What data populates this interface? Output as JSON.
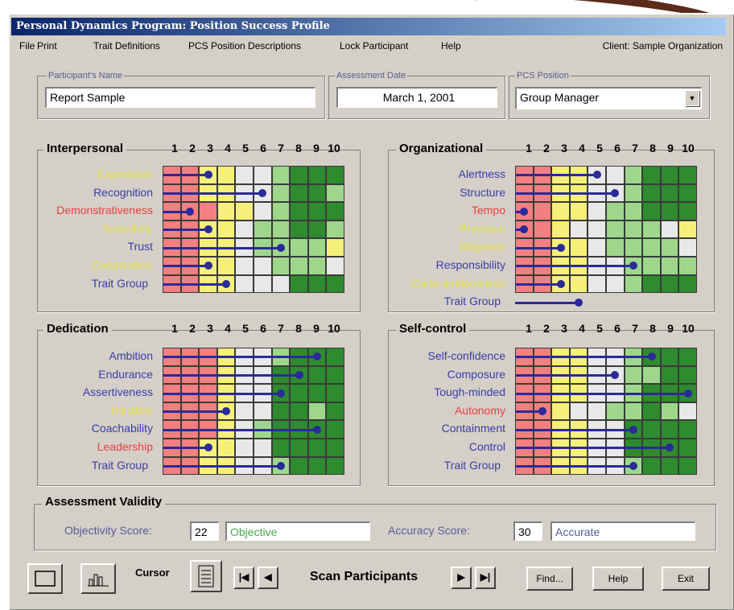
{
  "window": {
    "title": "Personal Dynamics Program: Position Success Profile"
  },
  "menu": {
    "items": [
      "File",
      "Print",
      "Trait Definitions",
      "PCS Position Descriptions",
      "Lock Participant",
      "Help"
    ],
    "client": "Client: Sample Organization"
  },
  "fields": {
    "participant_label": "Participant's Name",
    "participant_value": "Report Sample",
    "date_label": "Assessment Date",
    "date_value": "March 1, 2001",
    "position_label": "PCS Position",
    "position_value": "Group Manager"
  },
  "scale_numbers": [
    "1",
    "2",
    "3",
    "4",
    "5",
    "6",
    "7",
    "8",
    "9",
    "10"
  ],
  "colors": {
    "red": "#f28080",
    "yellow": "#f5f07a",
    "white": "#e8e8e8",
    "lightgreen": "#9ed78c",
    "green": "#2e8b2e",
    "bar": "#2a2a9a"
  },
  "sections": [
    {
      "title": "Interpersonal",
      "traits": [
        {
          "label": "Expression",
          "color": "#e8e24a",
          "score": 3
        },
        {
          "label": "Recognition",
          "color": "#3a3aa8",
          "score": 6
        },
        {
          "label": "Demonstrativeness",
          "color": "#e84040",
          "score": 2
        },
        {
          "label": "Sensitivity",
          "color": "#e8e24a",
          "score": 3
        },
        {
          "label": "Trust",
          "color": "#3a3aa8",
          "score": 7
        },
        {
          "label": "Cooperation",
          "color": "#e8e24a",
          "score": 3
        }
      ],
      "group_label": "Trait Group",
      "group_score": 4,
      "rows": [
        [
          "r",
          "r",
          "y",
          "y",
          "w",
          "w",
          "lg",
          "g",
          "g",
          "g"
        ],
        [
          "r",
          "r",
          "y",
          "y",
          "w",
          "w",
          "lg",
          "g",
          "g",
          "lg"
        ],
        [
          "r",
          "r",
          "r",
          "y",
          "y",
          "w",
          "lg",
          "g",
          "g",
          "g"
        ],
        [
          "r",
          "r",
          "y",
          "y",
          "w",
          "lg",
          "lg",
          "g",
          "g",
          "lg"
        ],
        [
          "r",
          "r",
          "y",
          "y",
          "w",
          "lg",
          "lg",
          "lg",
          "lg",
          "y"
        ],
        [
          "r",
          "r",
          "y",
          "y",
          "w",
          "w",
          "lg",
          "lg",
          "lg",
          "w"
        ],
        [
          "r",
          "r",
          "y",
          "y",
          "w",
          "w",
          "w",
          "g",
          "g",
          "g"
        ]
      ]
    },
    {
      "title": "Organizational",
      "traits": [
        {
          "label": "Alertness",
          "color": "#3a3aa8",
          "score": 5
        },
        {
          "label": "Structure",
          "color": "#3a3aa8",
          "score": 6
        },
        {
          "label": "Tempo",
          "color": "#e84040",
          "score": 1
        },
        {
          "label": "Precision",
          "color": "#e8e24a",
          "score": 1
        },
        {
          "label": "Diligence",
          "color": "#e8e24a",
          "score": 3
        },
        {
          "label": "Responsibility",
          "color": "#3a3aa8",
          "score": 7
        },
        {
          "label": "Conscientiousness",
          "color": "#e8e24a",
          "score": 3
        }
      ],
      "group_label": "Trait Group",
      "group_score": 4,
      "rows": [
        [
          "r",
          "r",
          "y",
          "y",
          "w",
          "w",
          "lg",
          "g",
          "g",
          "g"
        ],
        [
          "r",
          "r",
          "y",
          "y",
          "w",
          "w",
          "lg",
          "g",
          "g",
          "g"
        ],
        [
          "r",
          "r",
          "y",
          "y",
          "w",
          "lg",
          "lg",
          "g",
          "g",
          "g"
        ],
        [
          "r",
          "r",
          "y",
          "w",
          "w",
          "lg",
          "lg",
          "lg",
          "w",
          "y"
        ],
        [
          "r",
          "r",
          "y",
          "y",
          "w",
          "lg",
          "lg",
          "lg",
          "lg",
          "w"
        ],
        [
          "r",
          "r",
          "y",
          "y",
          "w",
          "w",
          "lg",
          "lg",
          "lg",
          "lg"
        ],
        [
          "r",
          "r",
          "y",
          "y",
          "w",
          "w",
          "lg",
          "g",
          "g",
          "g"
        ]
      ]
    },
    {
      "title": "Dedication",
      "traits": [
        {
          "label": "Ambition",
          "color": "#3a3aa8",
          "score": 9
        },
        {
          "label": "Endurance",
          "color": "#3a3aa8",
          "score": 8
        },
        {
          "label": "Assertiveness",
          "color": "#3a3aa8",
          "score": 7
        },
        {
          "label": "Initiative",
          "color": "#e8e24a",
          "score": 4
        },
        {
          "label": "Coachability",
          "color": "#3a3aa8",
          "score": 9
        },
        {
          "label": "Leadership",
          "color": "#e84040",
          "score": 3
        },
        {
          "label": "Trait Group",
          "color": "#3a3aa8",
          "score": 7
        }
      ],
      "group_label": "",
      "group_score": 0,
      "rows": [
        [
          "r",
          "r",
          "r",
          "y",
          "w",
          "w",
          "lg",
          "g",
          "g",
          "g"
        ],
        [
          "r",
          "r",
          "r",
          "y",
          "w",
          "w",
          "g",
          "g",
          "g",
          "g"
        ],
        [
          "r",
          "r",
          "r",
          "y",
          "w",
          "w",
          "g",
          "g",
          "g",
          "g"
        ],
        [
          "r",
          "r",
          "r",
          "y",
          "w",
          "w",
          "g",
          "g",
          "lg",
          "g"
        ],
        [
          "r",
          "r",
          "r",
          "y",
          "w",
          "lg",
          "g",
          "g",
          "g",
          "g"
        ],
        [
          "r",
          "r",
          "y",
          "y",
          "w",
          "w",
          "g",
          "g",
          "g",
          "g"
        ],
        [
          "r",
          "r",
          "y",
          "y",
          "w",
          "w",
          "lg",
          "g",
          "g",
          "g"
        ]
      ]
    },
    {
      "title": "Self-control",
      "traits": [
        {
          "label": "Self-confidence",
          "color": "#3a3aa8",
          "score": 8
        },
        {
          "label": "Composure",
          "color": "#3a3aa8",
          "score": 6
        },
        {
          "label": "Tough-minded",
          "color": "#3a3aa8",
          "score": 10
        },
        {
          "label": "Autonomy",
          "color": "#e84040",
          "score": 2
        },
        {
          "label": "Containment",
          "color": "#3a3aa8",
          "score": 7
        },
        {
          "label": "Control",
          "color": "#3a3aa8",
          "score": 9
        },
        {
          "label": "Trait Group",
          "color": "#3a3aa8",
          "score": 7
        }
      ],
      "group_label": "",
      "group_score": 0,
      "rows": [
        [
          "r",
          "r",
          "y",
          "y",
          "w",
          "w",
          "lg",
          "g",
          "g",
          "g"
        ],
        [
          "r",
          "r",
          "y",
          "y",
          "w",
          "w",
          "lg",
          "lg",
          "g",
          "g"
        ],
        [
          "r",
          "r",
          "y",
          "y",
          "w",
          "w",
          "lg",
          "g",
          "g",
          "g"
        ],
        [
          "r",
          "r",
          "y",
          "w",
          "w",
          "lg",
          "lg",
          "g",
          "lg",
          "w"
        ],
        [
          "r",
          "r",
          "y",
          "y",
          "w",
          "w",
          "g",
          "g",
          "g",
          "g"
        ],
        [
          "r",
          "r",
          "y",
          "y",
          "w",
          "w",
          "g",
          "g",
          "g",
          "g"
        ],
        [
          "r",
          "r",
          "y",
          "y",
          "w",
          "w",
          "lg",
          "g",
          "g",
          "g"
        ]
      ]
    }
  ],
  "validity": {
    "title": "Assessment Validity",
    "objectivity_label": "Objectivity Score:",
    "objectivity_value": "22",
    "objectivity_text": "Objective",
    "accuracy_label": "Accuracy Score:",
    "accuracy_value": "30",
    "accuracy_text": "Accurate"
  },
  "bottom": {
    "cursor_label": "Cursor",
    "scan_label": "Scan Participants",
    "find_label": "Find...",
    "help_label": "Help",
    "exit_label": "Exit"
  }
}
